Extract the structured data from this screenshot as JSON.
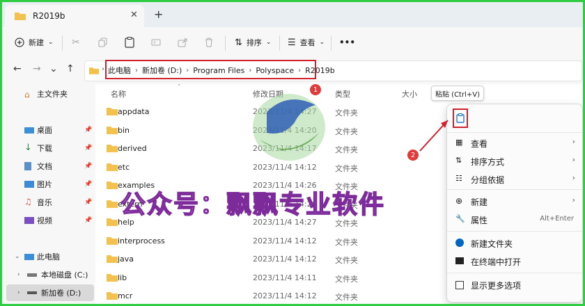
{
  "window": {
    "tab_title": "R2019b",
    "close_glyph": "✕",
    "new_tab_glyph": "+"
  },
  "toolbar": {
    "new_label": "新建",
    "sort_label": "排序",
    "view_label": "查看",
    "more_glyph": "•••"
  },
  "breadcrumb": [
    "此电脑",
    "新加卷 (D:)",
    "Program Files",
    "Polyspace",
    "R2019b"
  ],
  "columns": {
    "name": "名称",
    "date": "修改日期",
    "type": "类型",
    "size": "大小"
  },
  "sidebar": {
    "items": [
      {
        "label": "主文件夹",
        "icon": "home-icon",
        "pinned": false
      },
      {
        "label": "桌面",
        "icon": "desktop-icon",
        "pinned": true
      },
      {
        "label": "下载",
        "icon": "download-icon",
        "pinned": true
      },
      {
        "label": "文档",
        "icon": "document-icon",
        "pinned": true
      },
      {
        "label": "图片",
        "icon": "pictures-icon",
        "pinned": true
      },
      {
        "label": "音乐",
        "icon": "music-icon",
        "pinned": true
      },
      {
        "label": "视频",
        "icon": "video-icon",
        "pinned": true
      },
      {
        "label": "此电脑",
        "icon": "computer-icon",
        "pinned": false
      },
      {
        "label": "本地磁盘 (C:)",
        "icon": "drive-icon",
        "pinned": false
      },
      {
        "label": "新加卷 (D:)",
        "icon": "drive-icon",
        "pinned": false
      }
    ]
  },
  "files": [
    {
      "name": "appdata",
      "date": "2023/11/4 14:27",
      "type": "文件夹"
    },
    {
      "name": "bin",
      "date": "2023/11/4 14:20",
      "type": "文件夹"
    },
    {
      "name": "derived",
      "date": "2023/11/4 14:17",
      "type": "文件夹"
    },
    {
      "name": "etc",
      "date": "2023/11/4 14:12",
      "type": "文件夹"
    },
    {
      "name": "examples",
      "date": "2023/11/4 14:26",
      "type": "文件夹"
    },
    {
      "name": "extern",
      "date": "2023/11/4 14:26",
      "type": "文件夹"
    },
    {
      "name": "help",
      "date": "2023/11/4 14:27",
      "type": "文件夹"
    },
    {
      "name": "interprocess",
      "date": "2023/11/4 14:12",
      "type": "文件夹"
    },
    {
      "name": "java",
      "date": "2023/11/4 14:12",
      "type": "文件夹"
    },
    {
      "name": "lib",
      "date": "2023/11/4 14:11",
      "type": "文件夹"
    },
    {
      "name": "mcr",
      "date": "2023/11/4 14:12",
      "type": "文件夹"
    }
  ],
  "tooltip": "粘贴 (Ctrl+V)",
  "context_menu": {
    "items": [
      {
        "label": "查看",
        "icon": "grid-icon",
        "arrow": "›"
      },
      {
        "label": "排序方式",
        "icon": "sort-icon",
        "arrow": "›"
      },
      {
        "label": "分组依据",
        "icon": "group-icon",
        "arrow": "›"
      },
      {
        "label": "新建",
        "icon": "new-icon",
        "arrow": "›"
      },
      {
        "label": "属性",
        "icon": "wrench-icon",
        "shortcut": "Alt+Enter"
      },
      {
        "label": "新建文件夹",
        "icon": "new-folder-icon"
      },
      {
        "label": "在终端中打开",
        "icon": "terminal-icon"
      },
      {
        "label": "显示更多选项",
        "icon": "more-options-icon"
      }
    ]
  },
  "annotations": {
    "badge1": "1",
    "badge2": "2"
  },
  "watermark": "公众号：飘飘专业软件",
  "colors": {
    "highlight": "#d0202c",
    "folder": "#f2c14e",
    "accent": "#0067c0",
    "frame": "#2ecc40"
  }
}
